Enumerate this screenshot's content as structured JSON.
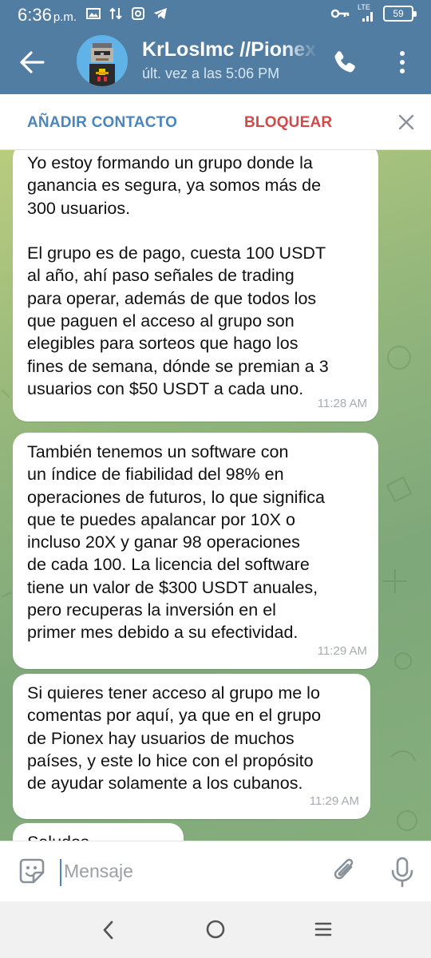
{
  "status_bar": {
    "time": "6:36",
    "ampm": "p.m.",
    "network": "LTE",
    "battery": "59"
  },
  "header": {
    "title": "KrLosImc //Pionex",
    "subtitle": "últ. vez a las 5:06 PM"
  },
  "actions": {
    "add_contact": "AÑADIR CONTACTO",
    "block": "BLOQUEAR"
  },
  "messages": [
    {
      "text": "Yo estoy formando un grupo donde la\nganancia es segura, ya somos más de\n300 usuarios.\n\nEl grupo es de pago, cuesta 100 USDT\nal año, ahí paso señales de trading\npara operar, además de que todos los\nque paguen el acceso al grupo son\nelegibles para sorteos que hago los\nfines de semana, dónde se premian a 3\nusuarios con $50 USDT a cada uno.",
      "time": "11:28 AM"
    },
    {
      "text": "También tenemos un software con\nun índice de fiabilidad del 98% en\noperaciones de futuros, lo que significa\nque te puedes apalancar por 10X o\nincluso 20X y ganar 98 operaciones\nde cada 100. La licencia del software\ntiene un valor de $300 USDT anuales,\npero recuperas la inversión en el\nprimer mes debido a su efectividad.",
      "time": "11:29 AM"
    },
    {
      "text": "Si quieres tener acceso al grupo me lo\ncomentas por aquí, ya que en el grupo\nde Pionex hay usuarios de muchos\npaíses, y este lo hice con el propósito\nde ayudar solamente a los cubanos.",
      "time": "11:29 AM"
    },
    {
      "text": "Saludos",
      "time": ""
    }
  ],
  "input": {
    "placeholder": "Mensaje"
  },
  "colors": {
    "header": "#517da2",
    "accent": "#4a86bb",
    "danger": "#d24949",
    "bubble": "#ffffff"
  }
}
